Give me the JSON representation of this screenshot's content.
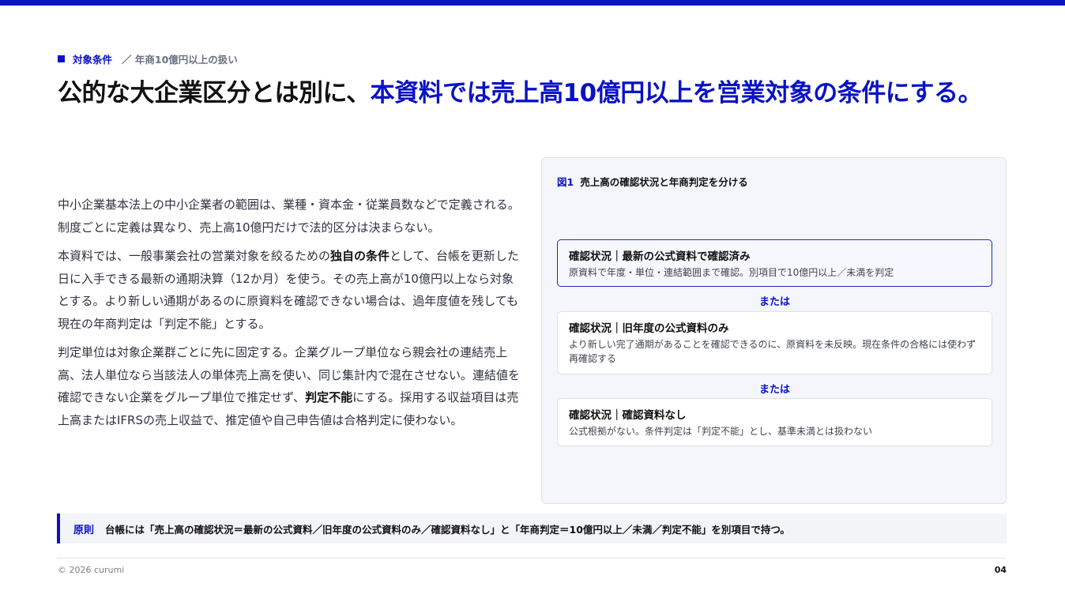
{
  "colors": {
    "accent": "#0a12c4",
    "text": "#1f2330",
    "muted": "#6b7080",
    "panel": "#f4f6fb"
  },
  "eyebrow": {
    "icon": "square-icon",
    "keyword": "対象条件",
    "sub": "／ 年商10億円以上の扱い"
  },
  "headline": {
    "part1": "公的な大企業区分とは別に、",
    "part2": "本資料では売上高10億円以上を営業対象の条件にする。"
  },
  "body": {
    "p1": "中小企業基本法上の中小企業者の範囲は、業種・資本金・従業員数などで定義される。制度ごとに定義は異なり、売上高10億円だけで法的区分は決まらない。",
    "p2_a": "本資料では、一般事業会社の営業対象を絞るための",
    "p2_b": "独自の条件",
    "p2_c": "として、台帳を更新した日に入手できる最新の通期決算（12か月）を使う。その売上高が10億円以上なら対象とする。より新しい通期があるのに原資料を確認できない場合は、過年度値を残しても現在の年商判定は「判定不能」とする。",
    "p3_a": "判定単位は対象企業群ごとに先に固定する。企業グループ単位なら親会社の連結売上高、法人単位なら当該法人の単体売上高を使い、同じ集計内で混在させない。連結値を確認できない企業をグループ単位で推定せず、",
    "p3_b": "判定不能",
    "p3_c": "にする。採用する収益項目は売上高またはIFRSの売上収益で、推定値や自己申告値は合格判定に使わない。"
  },
  "figure": {
    "num": "図1",
    "title": "売上高の確認状況と年商判定を分ける",
    "or_label": "または",
    "cards": [
      {
        "title": "確認状況｜最新の公式資料で確認済み",
        "desc": "原資料で年度・単位・連結範囲まで確認。別項目で10億円以上／未満を判定"
      },
      {
        "title": "確認状況｜旧年度の公式資料のみ",
        "desc": "より新しい完了通期があることを確認できるのに、原資料を未反映。現在条件の合格には使わず再確認する"
      },
      {
        "title": "確認状況｜確認資料なし",
        "desc": "公式根拠がない。条件判定は「判定不能」とし、基準未満とは扱わない"
      }
    ]
  },
  "rule": {
    "label": "原則",
    "text": "台帳には「売上高の確認状況＝最新の公式資料／旧年度の公式資料のみ／確認資料なし」と「年商判定＝10億円以上／未満／判定不能」を別項目で持つ。"
  },
  "footer": {
    "copyright": "© 2026 curumi",
    "page": "04"
  }
}
